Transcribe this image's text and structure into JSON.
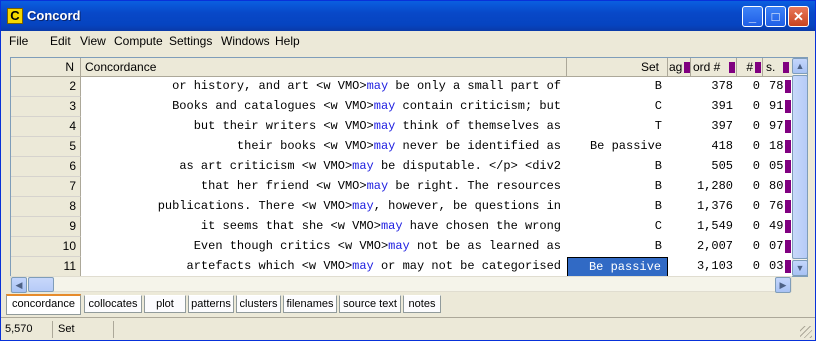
{
  "window": {
    "title": "Concord",
    "app_icon_letter": "C",
    "minimize": "_",
    "maximize": "□",
    "close": "✕"
  },
  "menu": [
    "File",
    "Edit",
    "View",
    "Compute",
    "Settings",
    "Windows",
    "Help"
  ],
  "columns": {
    "n": "N",
    "concordance": "Concordance",
    "set": "Set",
    "tag": "ag",
    "word": "ord #",
    "hash": "#",
    "pct": "s."
  },
  "rows": [
    {
      "n": "2",
      "pre": "or history, and art <w VMO>",
      "kw": "may",
      "post": " be only a small part of",
      "set": "B",
      "word": "378",
      "hash": "0",
      "pct": "78"
    },
    {
      "n": "3",
      "pre": "Books and catalogues <w VMO>",
      "kw": "may",
      "post": " contain criticism; but",
      "set": "C",
      "word": "391",
      "hash": "0",
      "pct": "91"
    },
    {
      "n": "4",
      "pre": "but their writers <w VMO>",
      "kw": "may",
      "post": " think of themselves as",
      "set": "T",
      "word": "397",
      "hash": "0",
      "pct": "97"
    },
    {
      "n": "5",
      "pre": "their books <w VMO>",
      "kw": "may",
      "post": " never be identified as",
      "set": "Be passive",
      "word": "418",
      "hash": "0",
      "pct": "18"
    },
    {
      "n": "6",
      "pre": "as art criticism <w VMO>",
      "kw": "may",
      "post": " be disputable. </p> <div2",
      "set": "B",
      "word": "505",
      "hash": "0",
      "pct": "05"
    },
    {
      "n": "7",
      "pre": "that her friend <w VMO>",
      "kw": "may",
      "post": " be right. The resources",
      "set": "B",
      "word": "1,280",
      "hash": "0",
      "pct": "80"
    },
    {
      "n": "8",
      "pre": "publications. There <w VMO>",
      "kw": "may",
      "post": ", however, be questions in",
      "set": "B",
      "word": "1,376",
      "hash": "0",
      "pct": "76"
    },
    {
      "n": "9",
      "pre": "it seems that she <w VMO>",
      "kw": "may",
      "post": " have chosen the wrong",
      "set": "C",
      "word": "1,549",
      "hash": "0",
      "pct": "49"
    },
    {
      "n": "10",
      "pre": "Even though critics <w VMO>",
      "kw": "may",
      "post": " not be as learned as",
      "set": "B",
      "word": "2,007",
      "hash": "0",
      "pct": "07"
    },
    {
      "n": "11",
      "pre": "artefacts which <w VMO>",
      "kw": "may",
      "post": " or may not be categorised",
      "set": "Be passive",
      "word": "3,103",
      "hash": "0",
      "pct": "03"
    }
  ],
  "tabs": [
    "concordance",
    "collocates",
    "plot",
    "patterns",
    "clusters",
    "filenames",
    "source text",
    "notes"
  ],
  "status": {
    "count": "5,570",
    "field": "Set"
  },
  "colors": {
    "title_bar": "#0848c8",
    "keyword": "#1c1ce0",
    "selection": "#316ac5",
    "marker": "#800080"
  }
}
